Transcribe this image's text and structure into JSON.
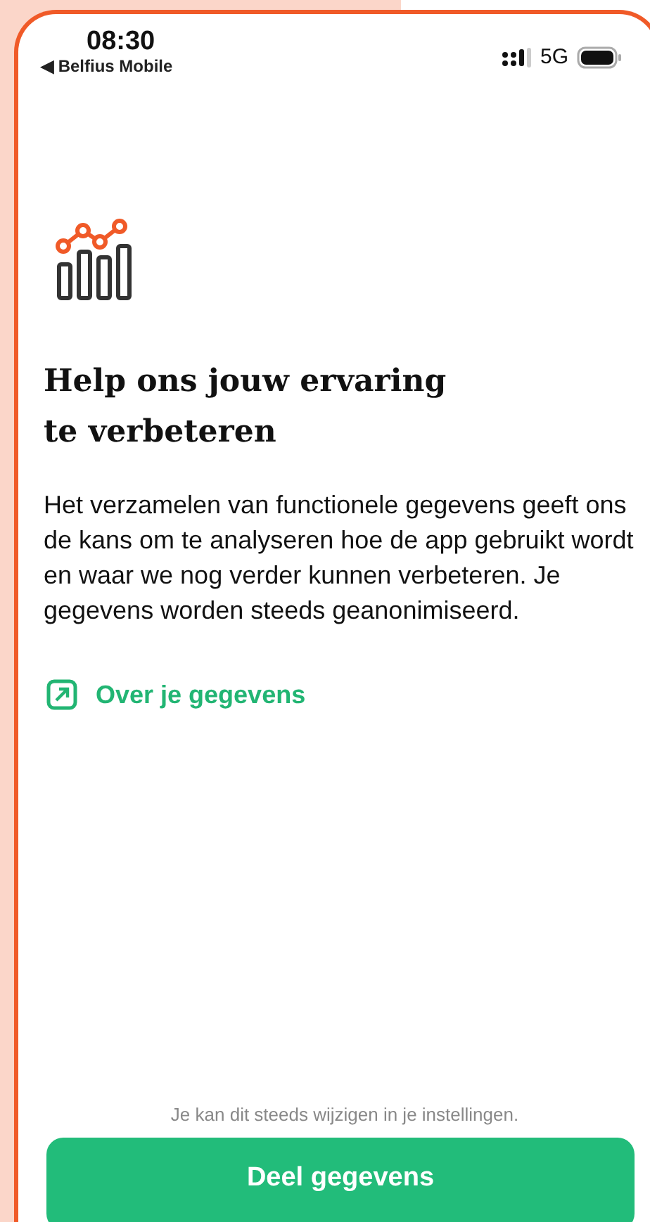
{
  "status_bar": {
    "time": "08:30",
    "back_label": "◀ Belfius Mobile",
    "network": "5G"
  },
  "title": "Help ons jouw ervaring te verbeteren",
  "body": "Het verzamelen van functionele gegevens geeft ons de kans om te analyseren hoe de app gebruikt wordt en waar we nog verder kunnen verbeteren. Je gegevens worden steeds geanonimiseerd.",
  "link": "Over je gegevens",
  "footer_note": "Je kan dit steeds wijzigen in je instellingen.",
  "primary_button": "Deel gegevens"
}
